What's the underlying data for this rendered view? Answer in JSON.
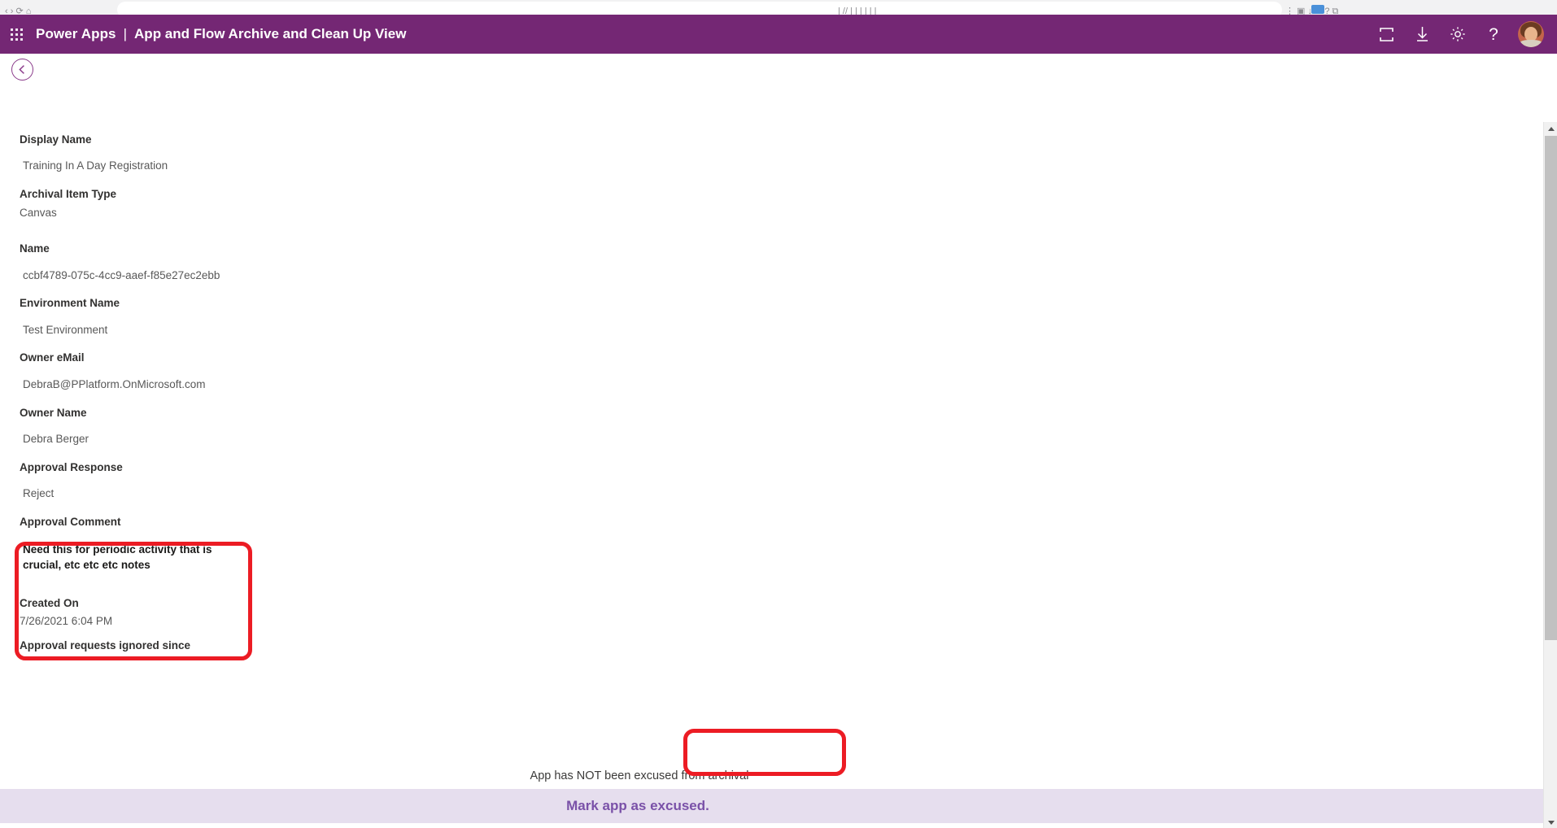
{
  "browser": {
    "omnibox_ghost_left": "‹ › ⟳ ⌂",
    "omnibox_ghost_mid": "| // | | | | | |",
    "omnibox_ghost_right": "⋮ ▣ ↓ ↗ ? ⧉"
  },
  "appbar": {
    "waffle_icon": "waffle-grid-icon",
    "brand": "Power Apps",
    "separator": "|",
    "app_title": "App and Flow Archive and Clean Up View",
    "actions": [
      {
        "icon": "fullscreen-icon",
        "name": "fullscreen-button"
      },
      {
        "icon": "download-icon",
        "name": "download-button"
      },
      {
        "icon": "gear-icon",
        "name": "settings-button"
      },
      {
        "icon": "help-icon",
        "glyph": "?",
        "name": "help-button"
      }
    ],
    "avatar": "user-avatar"
  },
  "page": {
    "back_icon": "chevron-left-icon"
  },
  "fields": [
    {
      "label": "Display Name",
      "value": "Training In A Day Registration"
    },
    {
      "label": "Archival Item Type",
      "value": "Canvas"
    },
    {
      "label": "Name",
      "value": "ccbf4789-075c-4cc9-aaef-f85e27ec2ebb"
    },
    {
      "label": "Environment Name",
      "value": "Test Environment"
    },
    {
      "label": "Owner eMail",
      "value": "DebraB@PPlatform.OnMicrosoft.com"
    },
    {
      "label": "Owner Name",
      "value": "Debra Berger"
    },
    {
      "label": "Approval Response",
      "value": "Reject"
    },
    {
      "label": "Approval Comment",
      "value": "Need this for periodic activity that is crucial, etc etc etc notes"
    },
    {
      "label": "Created On",
      "value": "7/26/2021 6:04 PM"
    },
    {
      "label": "Approval requests ignored since",
      "value": ""
    }
  ],
  "footer": {
    "status_text": "App has NOT been excused from archival",
    "button_label": "Mark app as excused."
  },
  "scrollbar": {
    "up_arrow": "scroll-up-arrow",
    "down_arrow": "scroll-down-arrow"
  },
  "colors": {
    "brand_purple": "#742774",
    "band_lavender": "#e6deee",
    "button_purple": "#7a51a8",
    "annotation_red": "#ec1c24"
  }
}
